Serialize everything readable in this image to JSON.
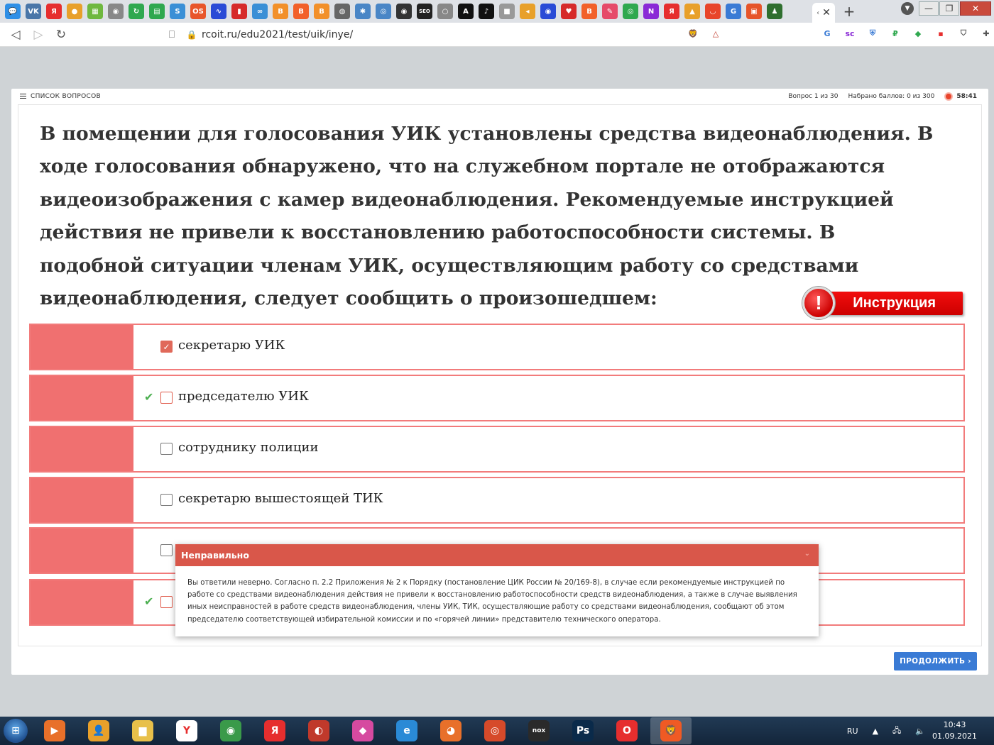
{
  "browser": {
    "url": "rcoit.ru/edu2021/test/uik/inye/",
    "tabs": [
      {
        "icon": "chat-icon",
        "color": "#2f8fe6",
        "glyph": "💬"
      },
      {
        "icon": "vk-icon",
        "color": "#4a76a8",
        "glyph": "VK"
      },
      {
        "icon": "yandex-icon",
        "color": "#e62e2e",
        "glyph": "Я"
      },
      {
        "icon": "ball-icon",
        "color": "#e8a02a",
        "glyph": "●"
      },
      {
        "icon": "grid-icon",
        "color": "#6fb83f",
        "glyph": "▦"
      },
      {
        "icon": "eye-icon",
        "color": "#888888",
        "glyph": "◉"
      },
      {
        "icon": "refresh-icon",
        "color": "#2fa84f",
        "glyph": "↻"
      },
      {
        "icon": "doc-icon",
        "color": "#2fa84f",
        "glyph": "▤"
      },
      {
        "icon": "serp-icon",
        "color": "#3a8fd6",
        "glyph": "S"
      },
      {
        "icon": "onlysurf-icon",
        "color": "#e8552a",
        "glyph": "OS"
      },
      {
        "icon": "chart-icon",
        "color": "#2a4bd6",
        "glyph": "∿"
      },
      {
        "icon": "bars-icon",
        "color": "#d62a2a",
        "glyph": "▮"
      },
      {
        "icon": "link-icon",
        "color": "#3a8fd6",
        "glyph": "∞"
      },
      {
        "icon": "blog-icon",
        "color": "#f2902a",
        "glyph": "B"
      },
      {
        "icon": "b-icon",
        "color": "#f2602a",
        "glyph": "B"
      },
      {
        "icon": "blogger-icon",
        "color": "#f2902a",
        "glyph": "B"
      },
      {
        "icon": "globe-icon",
        "color": "#666666",
        "glyph": "◍"
      },
      {
        "icon": "atom-icon",
        "color": "#4a86c6",
        "glyph": "✱"
      },
      {
        "icon": "radar-icon",
        "color": "#4a86c6",
        "glyph": "◎"
      },
      {
        "icon": "eye2-icon",
        "color": "#333333",
        "glyph": "◉"
      },
      {
        "icon": "seo-icon",
        "color": "#222222",
        "glyph": "SEO"
      },
      {
        "icon": "circle-icon",
        "color": "#888888",
        "glyph": "○"
      },
      {
        "icon": "a-icon",
        "color": "#111111",
        "glyph": "A"
      },
      {
        "icon": "tiktok-icon",
        "color": "#111111",
        "glyph": "♪"
      },
      {
        "icon": "cube-icon",
        "color": "#999999",
        "glyph": "■"
      },
      {
        "icon": "arrow-icon",
        "color": "#e8a02a",
        "glyph": "◂"
      },
      {
        "icon": "owl-icon",
        "color": "#2a4bd6",
        "glyph": "◉"
      },
      {
        "icon": "heart-icon",
        "color": "#d62a2a",
        "glyph": "♥"
      },
      {
        "icon": "blogger2-icon",
        "color": "#f2602a",
        "glyph": "B"
      },
      {
        "icon": "page-icon",
        "color": "#e64a6a",
        "glyph": "✎"
      },
      {
        "icon": "target-icon",
        "color": "#2fa84f",
        "glyph": "◎"
      },
      {
        "icon": "n-icon",
        "color": "#8a2ad6",
        "glyph": "N"
      },
      {
        "icon": "ya2-icon",
        "color": "#e62e2e",
        "glyph": "Я"
      },
      {
        "icon": "mountain-icon",
        "color": "#e8a02a",
        "glyph": "▲"
      },
      {
        "icon": "pocket-icon",
        "color": "#e8452a",
        "glyph": "◡"
      },
      {
        "icon": "google-icon",
        "color": "#3a7bd5",
        "glyph": "G"
      },
      {
        "icon": "square-icon",
        "color": "#e6552a",
        "glyph": "▣"
      },
      {
        "icon": "people-icon",
        "color": "#2f6f2f",
        "glyph": "♟"
      }
    ],
    "extensions": [
      {
        "icon": "brave-icon",
        "color": "#f05a24",
        "glyph": "🦁"
      },
      {
        "icon": "triangle-icon",
        "color": "#c0392b",
        "glyph": "△"
      },
      {
        "icon": "translate-icon",
        "color": "#3a7bd5",
        "glyph": "G"
      },
      {
        "icon": "sc-icon",
        "color": "#8a2ad6",
        "glyph": "sc"
      },
      {
        "icon": "lock-ext-icon",
        "color": "#3a7bd5",
        "glyph": "⛨"
      },
      {
        "icon": "ruble-icon",
        "color": "#2fa84f",
        "glyph": "₽"
      },
      {
        "icon": "cube-ext-icon",
        "color": "#2fa84f",
        "glyph": "◆"
      },
      {
        "icon": "red-ext-icon",
        "color": "#e62e2e",
        "glyph": "▪"
      },
      {
        "icon": "shield-icon",
        "color": "#555555",
        "glyph": "⛉"
      },
      {
        "icon": "puzzle-icon",
        "color": "#555555",
        "glyph": "✚"
      },
      {
        "icon": "menu-icon",
        "color": "#555555",
        "glyph": "≡"
      }
    ]
  },
  "header": {
    "questions_list": "СПИСОК ВОПРОСОВ",
    "question_counter": "Вопрос 1 из 30",
    "score": "Набрано баллов: 0 из 300",
    "timer": "58:41",
    "accent": "#e9442c"
  },
  "question": {
    "text": "В помещении для голосования УИК установлены средства видеонаблюдения. В ходе голосования обнаружено, что на служебном портале не отображаются видеоизображения с камер видеонаблюдения. Рекомендуемые инструкцией действия не привели к восстановлению работоспособности системы. В подобной ситуации членам УИК, осуществляющим работу со средствами видеонаблюдения, следует сообщить о произошедшем:"
  },
  "instruction_button": {
    "label": "Инструкция",
    "mark": "!"
  },
  "answers": [
    {
      "label": "секретарю УИК",
      "checked": true,
      "correct": false
    },
    {
      "label": "председателю УИК",
      "checked": false,
      "correct": true
    },
    {
      "label": "сотруднику полиции",
      "checked": false,
      "correct": false
    },
    {
      "label": "секретарю вышестоящей ТИК",
      "checked": false,
      "correct": false
    },
    {
      "label": "",
      "checked": false,
      "correct": false
    },
    {
      "label": "",
      "checked": false,
      "correct": true
    }
  ],
  "feedback": {
    "title": "Неправильно",
    "text": "Вы ответили неверно. Согласно п. 2.2 Приложения № 2 к Порядку (постановление ЦИК России № 20/169-8), в случае если рекомендуемые инструкцией по работе со средствами видеонаблюдения действия не привели к восстановлению работоспособности средств видеонаблюдения, а также в случае выявления иных неисправностей в работе средств видеонаблюдения, члены УИК, ТИК, осуществляющие работу со средствами видеонаблюдения, сообщают об этом председателю соответствующей избирательной комиссии и по «горячей линии» представителю технического оператора.",
    "color": "#d9574a"
  },
  "continue_button": {
    "label": "ПРОДОЛЖИТЬ ›",
    "color": "#3a7bd5"
  },
  "taskbar": {
    "apps": [
      {
        "name": "media-player",
        "color": "#e8702a",
        "glyph": "▶"
      },
      {
        "name": "contacts",
        "color": "#e8a02a",
        "glyph": "👤"
      },
      {
        "name": "explorer",
        "color": "#e8c04a",
        "glyph": "▆"
      },
      {
        "name": "yandex-browser",
        "color": "#ffffff",
        "glyph": "Y"
      },
      {
        "name": "chrome",
        "color": "#3a9a4a",
        "glyph": "◉"
      },
      {
        "name": "yandex",
        "color": "#e62e2e",
        "glyph": "Я"
      },
      {
        "name": "app-red",
        "color": "#c0392b",
        "glyph": "◐"
      },
      {
        "name": "app-gem",
        "color": "#d64aa0",
        "glyph": "◆"
      },
      {
        "name": "ie",
        "color": "#2a8ad6",
        "glyph": "e"
      },
      {
        "name": "firefox",
        "color": "#e8702a",
        "glyph": "◕"
      },
      {
        "name": "app-ring",
        "color": "#d64a2a",
        "glyph": "◎"
      },
      {
        "name": "nox",
        "color": "#2a2a2a",
        "glyph": "nox"
      },
      {
        "name": "photoshop",
        "color": "#0a2a4a",
        "glyph": "Ps"
      },
      {
        "name": "opera",
        "color": "#e62e2e",
        "glyph": "O"
      },
      {
        "name": "brave",
        "color": "#f05a24",
        "glyph": "🦁"
      }
    ],
    "lang": "RU",
    "time": "10:43",
    "date": "01.09.2021"
  }
}
